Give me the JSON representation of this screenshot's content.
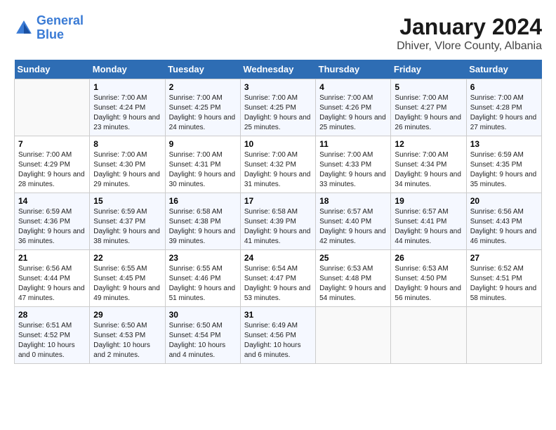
{
  "header": {
    "logo_line1": "General",
    "logo_line2": "Blue",
    "title": "January 2024",
    "subtitle": "Dhiver, Vlore County, Albania"
  },
  "calendar": {
    "days_of_week": [
      "Sunday",
      "Monday",
      "Tuesday",
      "Wednesday",
      "Thursday",
      "Friday",
      "Saturday"
    ],
    "weeks": [
      [
        {
          "date": "",
          "sunrise": "",
          "sunset": "",
          "daylight": ""
        },
        {
          "date": "1",
          "sunrise": "7:00 AM",
          "sunset": "4:24 PM",
          "daylight": "9 hours and 23 minutes."
        },
        {
          "date": "2",
          "sunrise": "7:00 AM",
          "sunset": "4:25 PM",
          "daylight": "9 hours and 24 minutes."
        },
        {
          "date": "3",
          "sunrise": "7:00 AM",
          "sunset": "4:25 PM",
          "daylight": "9 hours and 25 minutes."
        },
        {
          "date": "4",
          "sunrise": "7:00 AM",
          "sunset": "4:26 PM",
          "daylight": "9 hours and 25 minutes."
        },
        {
          "date": "5",
          "sunrise": "7:00 AM",
          "sunset": "4:27 PM",
          "daylight": "9 hours and 26 minutes."
        },
        {
          "date": "6",
          "sunrise": "7:00 AM",
          "sunset": "4:28 PM",
          "daylight": "9 hours and 27 minutes."
        }
      ],
      [
        {
          "date": "7",
          "sunrise": "7:00 AM",
          "sunset": "4:29 PM",
          "daylight": "9 hours and 28 minutes."
        },
        {
          "date": "8",
          "sunrise": "7:00 AM",
          "sunset": "4:30 PM",
          "daylight": "9 hours and 29 minutes."
        },
        {
          "date": "9",
          "sunrise": "7:00 AM",
          "sunset": "4:31 PM",
          "daylight": "9 hours and 30 minutes."
        },
        {
          "date": "10",
          "sunrise": "7:00 AM",
          "sunset": "4:32 PM",
          "daylight": "9 hours and 31 minutes."
        },
        {
          "date": "11",
          "sunrise": "7:00 AM",
          "sunset": "4:33 PM",
          "daylight": "9 hours and 33 minutes."
        },
        {
          "date": "12",
          "sunrise": "7:00 AM",
          "sunset": "4:34 PM",
          "daylight": "9 hours and 34 minutes."
        },
        {
          "date": "13",
          "sunrise": "6:59 AM",
          "sunset": "4:35 PM",
          "daylight": "9 hours and 35 minutes."
        }
      ],
      [
        {
          "date": "14",
          "sunrise": "6:59 AM",
          "sunset": "4:36 PM",
          "daylight": "9 hours and 36 minutes."
        },
        {
          "date": "15",
          "sunrise": "6:59 AM",
          "sunset": "4:37 PM",
          "daylight": "9 hours and 38 minutes."
        },
        {
          "date": "16",
          "sunrise": "6:58 AM",
          "sunset": "4:38 PM",
          "daylight": "9 hours and 39 minutes."
        },
        {
          "date": "17",
          "sunrise": "6:58 AM",
          "sunset": "4:39 PM",
          "daylight": "9 hours and 41 minutes."
        },
        {
          "date": "18",
          "sunrise": "6:57 AM",
          "sunset": "4:40 PM",
          "daylight": "9 hours and 42 minutes."
        },
        {
          "date": "19",
          "sunrise": "6:57 AM",
          "sunset": "4:41 PM",
          "daylight": "9 hours and 44 minutes."
        },
        {
          "date": "20",
          "sunrise": "6:56 AM",
          "sunset": "4:43 PM",
          "daylight": "9 hours and 46 minutes."
        }
      ],
      [
        {
          "date": "21",
          "sunrise": "6:56 AM",
          "sunset": "4:44 PM",
          "daylight": "9 hours and 47 minutes."
        },
        {
          "date": "22",
          "sunrise": "6:55 AM",
          "sunset": "4:45 PM",
          "daylight": "9 hours and 49 minutes."
        },
        {
          "date": "23",
          "sunrise": "6:55 AM",
          "sunset": "4:46 PM",
          "daylight": "9 hours and 51 minutes."
        },
        {
          "date": "24",
          "sunrise": "6:54 AM",
          "sunset": "4:47 PM",
          "daylight": "9 hours and 53 minutes."
        },
        {
          "date": "25",
          "sunrise": "6:53 AM",
          "sunset": "4:48 PM",
          "daylight": "9 hours and 54 minutes."
        },
        {
          "date": "26",
          "sunrise": "6:53 AM",
          "sunset": "4:50 PM",
          "daylight": "9 hours and 56 minutes."
        },
        {
          "date": "27",
          "sunrise": "6:52 AM",
          "sunset": "4:51 PM",
          "daylight": "9 hours and 58 minutes."
        }
      ],
      [
        {
          "date": "28",
          "sunrise": "6:51 AM",
          "sunset": "4:52 PM",
          "daylight": "10 hours and 0 minutes."
        },
        {
          "date": "29",
          "sunrise": "6:50 AM",
          "sunset": "4:53 PM",
          "daylight": "10 hours and 2 minutes."
        },
        {
          "date": "30",
          "sunrise": "6:50 AM",
          "sunset": "4:54 PM",
          "daylight": "10 hours and 4 minutes."
        },
        {
          "date": "31",
          "sunrise": "6:49 AM",
          "sunset": "4:56 PM",
          "daylight": "10 hours and 6 minutes."
        },
        {
          "date": "",
          "sunrise": "",
          "sunset": "",
          "daylight": ""
        },
        {
          "date": "",
          "sunrise": "",
          "sunset": "",
          "daylight": ""
        },
        {
          "date": "",
          "sunrise": "",
          "sunset": "",
          "daylight": ""
        }
      ]
    ]
  },
  "labels": {
    "sunrise_prefix": "Sunrise: ",
    "sunset_prefix": "Sunset: ",
    "daylight_prefix": "Daylight: "
  }
}
